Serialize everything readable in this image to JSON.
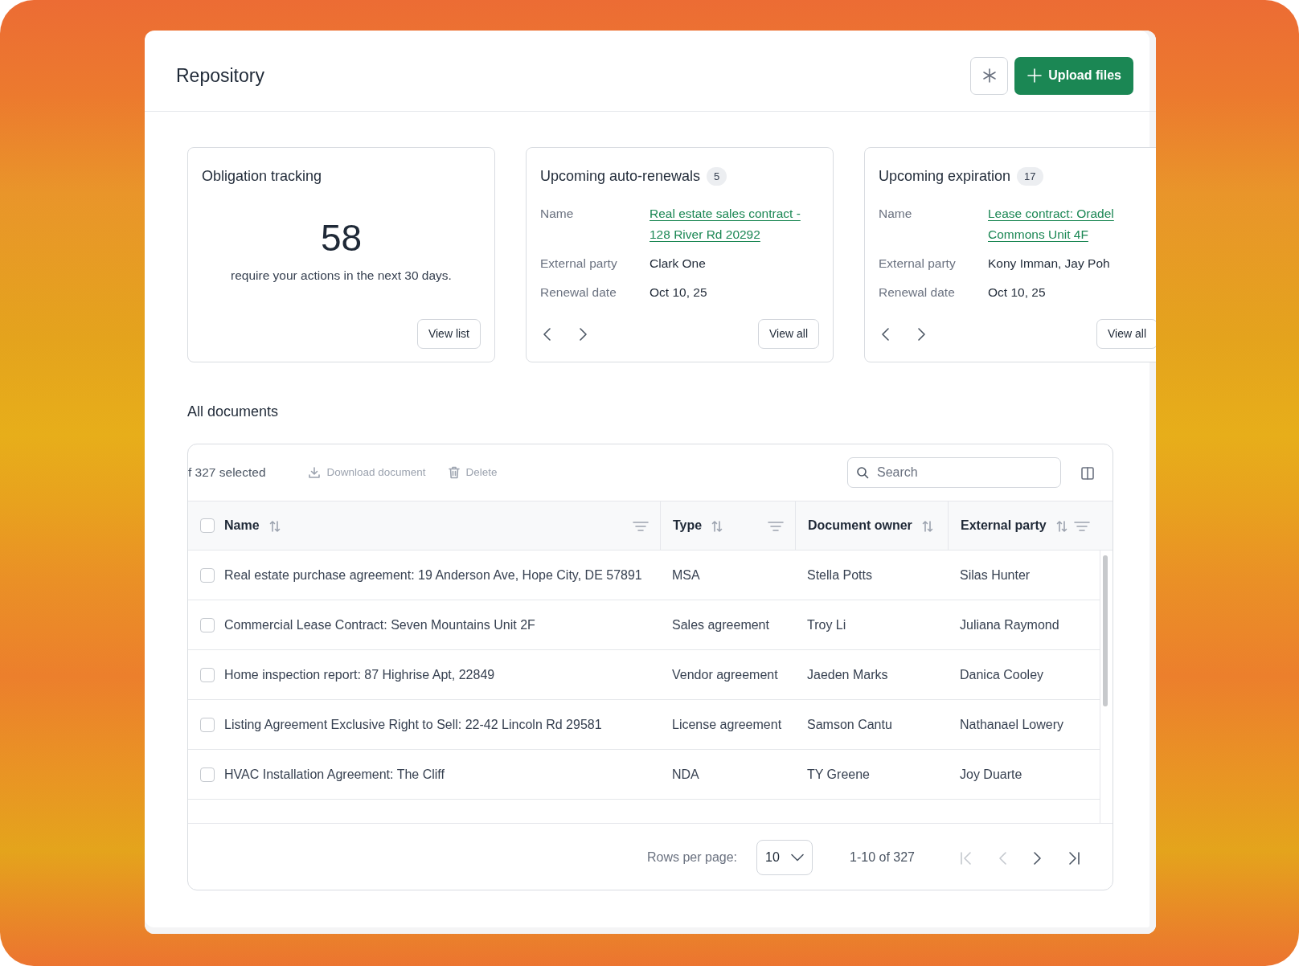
{
  "header": {
    "title": "Repository",
    "upload_button": "Upload files"
  },
  "cards": [
    {
      "kind": "stat",
      "title": "Obligation tracking",
      "value": "58",
      "caption": "require your actions in the next 30 days.",
      "button": "View list"
    },
    {
      "kind": "list",
      "title": "Upcoming auto-renewals",
      "count": "5",
      "fields": [
        {
          "label": "Name",
          "value": "Real estate sales contract - 128 River Rd 20292",
          "kind": "link"
        },
        {
          "label": "External party",
          "value": "Clark One",
          "kind": "text"
        },
        {
          "label": "Renewal date",
          "value": "Oct 10, 25",
          "kind": "text"
        }
      ],
      "button": "View all"
    },
    {
      "kind": "list",
      "title": "Upcoming expiration",
      "count": "17",
      "fields": [
        {
          "label": "Name",
          "value": "Lease contract: Oradel Commons Unit 4F",
          "kind": "link"
        },
        {
          "label": "External party",
          "value": "Kony Imman, Jay Poh",
          "kind": "text"
        },
        {
          "label": "Renewal date",
          "value": "Oct 10, 25",
          "kind": "text"
        }
      ],
      "button": "View all"
    }
  ],
  "documents": {
    "title": "All documents",
    "selection": "f 327 selected",
    "actions": [
      {
        "kind": "download",
        "label": "Download document",
        "disabled": true
      },
      {
        "kind": "delete",
        "label": "Delete",
        "disabled": true
      }
    ],
    "search": {
      "placeholder": "Search"
    },
    "header_checked": false,
    "columns": [
      {
        "label": "Name",
        "filter": true
      },
      {
        "label": "Type",
        "filter": true
      },
      {
        "label": "Document owner",
        "filter": false
      },
      {
        "label": "External party",
        "filter": true
      }
    ],
    "rows": [
      {
        "checked": false,
        "cells": [
          "Real estate purchase agreement: 19 Anderson Ave, Hope City, DE 57891",
          "MSA",
          "Stella Potts",
          "Silas Hunter"
        ]
      },
      {
        "checked": false,
        "cells": [
          "Commercial Lease Contract: Seven Mountains Unit 2F",
          "Sales agreement",
          "Troy Li",
          "Juliana Raymond"
        ]
      },
      {
        "checked": false,
        "cells": [
          "Home inspection report: 87 Highrise Apt, 22849",
          "Vendor agreement",
          "Jaeden Marks",
          "Danica Cooley"
        ]
      },
      {
        "checked": false,
        "cells": [
          "Listing Agreement Exclusive Right to Sell: 22-42 Lincoln Rd 29581",
          "License agreement",
          "Samson Cantu",
          "Nathanael Lowery"
        ]
      },
      {
        "checked": false,
        "cells": [
          "HVAC Installation Agreement: The Cliff",
          "NDA",
          "TY Greene",
          "Joy Duarte"
        ]
      }
    ],
    "footer": {
      "rows_label": "Rows per page:",
      "rows_value": "10",
      "range": "1-10 of 327",
      "pager": [
        {
          "kind": "first",
          "disabled": true
        },
        {
          "kind": "prev",
          "disabled": true
        },
        {
          "kind": "next",
          "disabled": false
        },
        {
          "kind": "last",
          "disabled": false
        }
      ]
    }
  }
}
